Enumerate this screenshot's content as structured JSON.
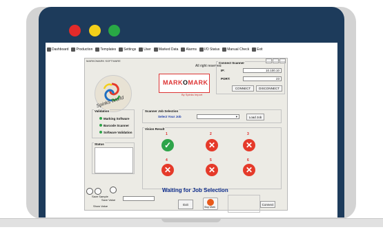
{
  "window": {
    "controls": [
      "close",
      "minimize",
      "maximize"
    ]
  },
  "menu": [
    {
      "label": "Dashboard",
      "icon": "dashboard-icon"
    },
    {
      "label": "Production",
      "icon": "production-icon"
    },
    {
      "label": "Templates",
      "icon": "templates-icon"
    },
    {
      "label": "Settings",
      "icon": "settings-icon"
    },
    {
      "label": "User",
      "icon": "user-icon"
    },
    {
      "label": "Marked Data",
      "icon": "marked-data-icon"
    },
    {
      "label": "Alarms",
      "icon": "alarms-icon"
    },
    {
      "label": "I/O Status",
      "icon": "io-status-icon"
    },
    {
      "label": "Manual Check",
      "icon": "manual-check-icon"
    },
    {
      "label": "Exit",
      "icon": "exit-icon"
    }
  ],
  "app": {
    "title": "MARKOMARK SOFTWARE",
    "rights": "All right reserved",
    "brand": {
      "left": "MARK",
      "right": "MARK",
      "mid": "O"
    },
    "byline": "By Spinks Import",
    "logo_text": "Spinks World"
  },
  "connect": {
    "title": "Connect Scanner",
    "ip_label": "IP:",
    "ip_value": "10.100.10",
    "port_label": "PORT:",
    "port_value": "23",
    "connect_btn": "CONNECT",
    "disconnect_btn": "DISCONNECT"
  },
  "validation": {
    "title": "Validation",
    "items": [
      "Marking Software",
      "Barcode Scanner",
      "Software Validation"
    ]
  },
  "status": {
    "title": "Status"
  },
  "job": {
    "title": "Scanner Job Selection",
    "select_label": "Select Your Job",
    "load_btn": "Load Job"
  },
  "vision": {
    "title": "Vision Result",
    "cams": [
      {
        "n": "1",
        "state": "ok"
      },
      {
        "n": "2",
        "state": "fail"
      },
      {
        "n": "3",
        "state": "fail"
      },
      {
        "n": "4",
        "state": "fail"
      },
      {
        "n": "5",
        "state": "fail"
      },
      {
        "n": "6",
        "state": "fail"
      }
    ]
  },
  "waiting": "Waiting for Job Selection",
  "tools": {
    "save_sample": "Save Sample",
    "save_value": "Save Value",
    "show_value": "Show Value"
  },
  "exit_btn": "Exit",
  "stop_label": "Stop Mark",
  "connect_btn2": "Connect"
}
